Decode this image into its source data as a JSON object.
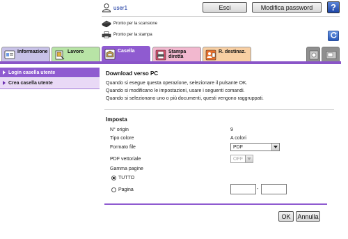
{
  "header": {
    "user_name": "user1",
    "logout_label": "Esci",
    "change_password_label": "Modifica password",
    "help_label": "?"
  },
  "status": {
    "scan_ready": "Pronto per la scansione",
    "print_ready": "Pronto per la stampa"
  },
  "tabs": [
    {
      "label": "Informazione"
    },
    {
      "label": "Lavoro"
    },
    {
      "label": "Casella"
    },
    {
      "label": "Stampa diretta"
    },
    {
      "label": "R. destinaz."
    }
  ],
  "sidebar": {
    "items": [
      {
        "label": "Login casella utente"
      },
      {
        "label": "Crea casella utente"
      }
    ]
  },
  "main": {
    "title": "Download verso PC",
    "desc": [
      "Quando si esegue questa operazione, selezionare il pulsante OK.",
      "Quando si modificano le impostazioni, usare i seguenti comandi.",
      "Quando si selezionano uno o più documenti, questi vengono raggruppati."
    ],
    "section_title": "Imposta",
    "fields": {
      "num_origin_label": "N° origin",
      "num_origin_value": "9",
      "color_type_label": "Tipo colore",
      "color_type_value": "A colori",
      "file_format_label": "Formato file",
      "file_format_value": "PDF",
      "vector_pdf_label": "PDF vettoriale",
      "vector_pdf_value": "OFF",
      "page_range_label": "Gamma pagine",
      "all_label": "TUTTO",
      "page_label": "Pagina",
      "range_separator": "-"
    },
    "ok_label": "OK",
    "cancel_label": "Annulla"
  },
  "colors": {
    "accent": "#8f5bd0",
    "accent_light": "#e9d9f6"
  }
}
